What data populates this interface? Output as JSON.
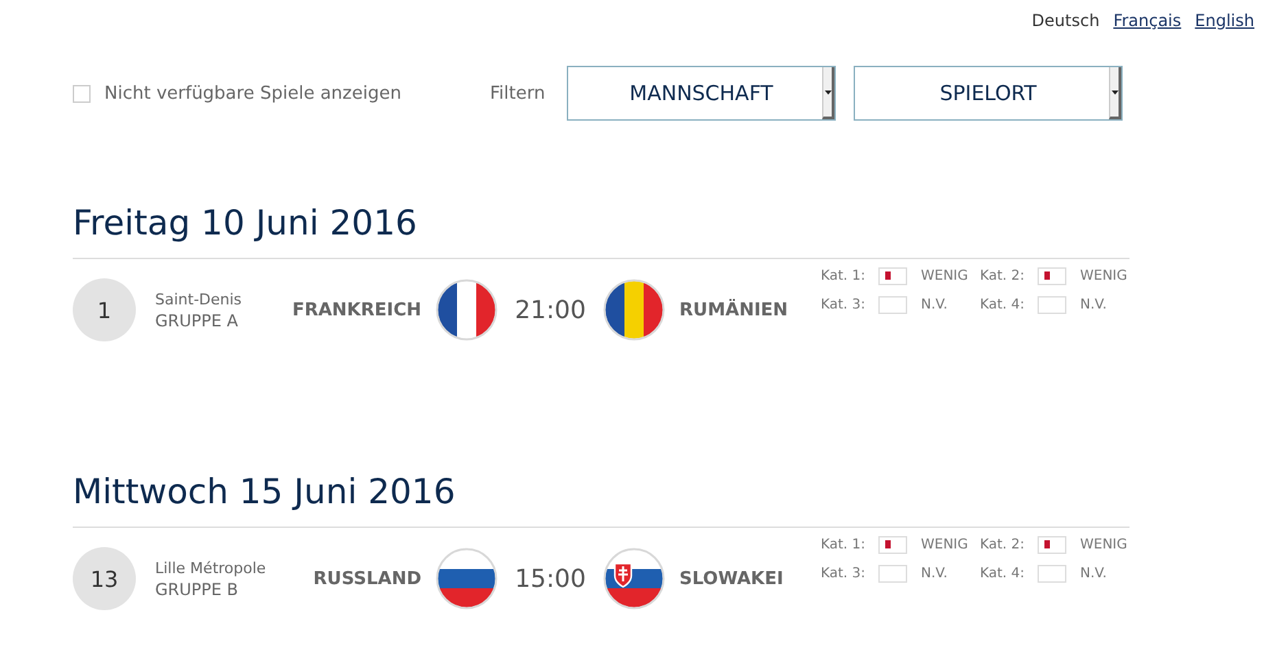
{
  "languages": [
    {
      "label": "Deutsch",
      "selected": true
    },
    {
      "label": "Français",
      "selected": false
    },
    {
      "label": "English",
      "selected": false
    }
  ],
  "filters": {
    "unavailable": {
      "label": "Nicht verfügbare Spiele anzeigen",
      "checked": false
    },
    "label": "Filtern",
    "dropdowns": [
      "MANNSCHAFT",
      "SPIELORT"
    ]
  },
  "days": [
    {
      "date": "Freitag 10 Juni 2016",
      "matches": [
        {
          "number": "1",
          "venue": "Saint-Denis",
          "group": "GRUPPE A",
          "home": {
            "name": "FRANKREICH",
            "kind": "france"
          },
          "time": "21:00",
          "away": {
            "name": "RUMÄNIEN",
            "kind": "romania"
          },
          "categories": [
            {
              "label": "Kat. 1:",
              "available": true,
              "status": "WENIG"
            },
            {
              "label": "Kat. 2:",
              "available": true,
              "status": "WENIG"
            },
            {
              "label": "Kat. 3:",
              "available": false,
              "status": "N.V."
            },
            {
              "label": "Kat. 4:",
              "available": false,
              "status": "N.V."
            }
          ]
        }
      ]
    },
    {
      "date": "Mittwoch 15 Juni 2016",
      "matches": [
        {
          "number": "13",
          "venue": "Lille Métropole",
          "group": "GRUPPE B",
          "home": {
            "name": "RUSSLAND",
            "kind": "russia"
          },
          "time": "15:00",
          "away": {
            "name": "SLOWAKEI",
            "kind": "slovakia"
          },
          "categories": [
            {
              "label": "Kat. 1:",
              "available": true,
              "status": "WENIG"
            },
            {
              "label": "Kat. 2:",
              "available": true,
              "status": "WENIG"
            },
            {
              "label": "Kat. 3:",
              "available": false,
              "status": "N.V."
            },
            {
              "label": "Kat. 4:",
              "available": false,
              "status": "N.V."
            }
          ]
        }
      ]
    }
  ]
}
